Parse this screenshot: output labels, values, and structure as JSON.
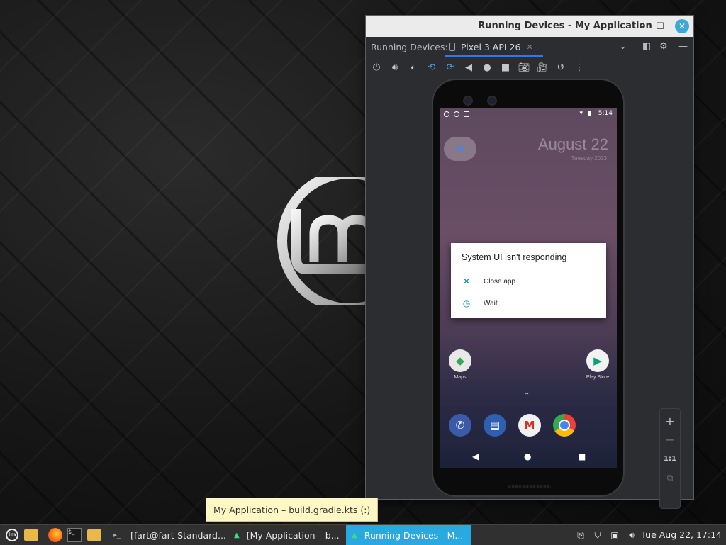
{
  "desktop": {
    "wallpaper": "linux-mint-dark"
  },
  "window": {
    "title": "Running Devices - My Application",
    "tabbar": {
      "label": "Running Devices:",
      "tab_name": "Pixel 3 API 26"
    },
    "toolbar_icons": [
      "power-icon",
      "volume-up-icon",
      "volume-down-icon",
      "rotate-left-icon",
      "rotate-right-icon",
      "back-icon",
      "home-icon",
      "overview-icon",
      "camera-icon",
      "record-icon",
      "snapshot-icon",
      "more-icon"
    ],
    "zoom": {
      "plus": "+",
      "minus": "−",
      "one_to_one": "1:1"
    }
  },
  "phone": {
    "status_time": "5:14",
    "google_letter": "G",
    "date": "August 22",
    "date_sub": "Tuesday 2023",
    "dialog": {
      "title": "System UI isn't responding",
      "options": [
        {
          "icon": "close-icon",
          "label": "Close app"
        },
        {
          "icon": "clock-icon",
          "label": "Wait"
        }
      ]
    },
    "apps": [
      {
        "name": "Maps"
      },
      {
        "name": "Play Store"
      }
    ],
    "dock": [
      "phone-icon",
      "messages-icon",
      "gmail-icon",
      "chrome-icon"
    ]
  },
  "tooltip": "My Application – build.gradle.kts (:)",
  "taskbar": {
    "tasks": [
      {
        "label": "[fart@fart-Standard...",
        "icon": "terminal-icon"
      },
      {
        "label": "[My Application – b...",
        "icon": "android-studio-icon"
      },
      {
        "label": "Running Devices - M...",
        "icon": "android-icon",
        "active": true
      }
    ],
    "clock": "Tue Aug 22, 17:14"
  },
  "colors": {
    "accent": "#2aa9e0",
    "tab_underline": "#3574f0",
    "dialog_icon": "#009688"
  }
}
